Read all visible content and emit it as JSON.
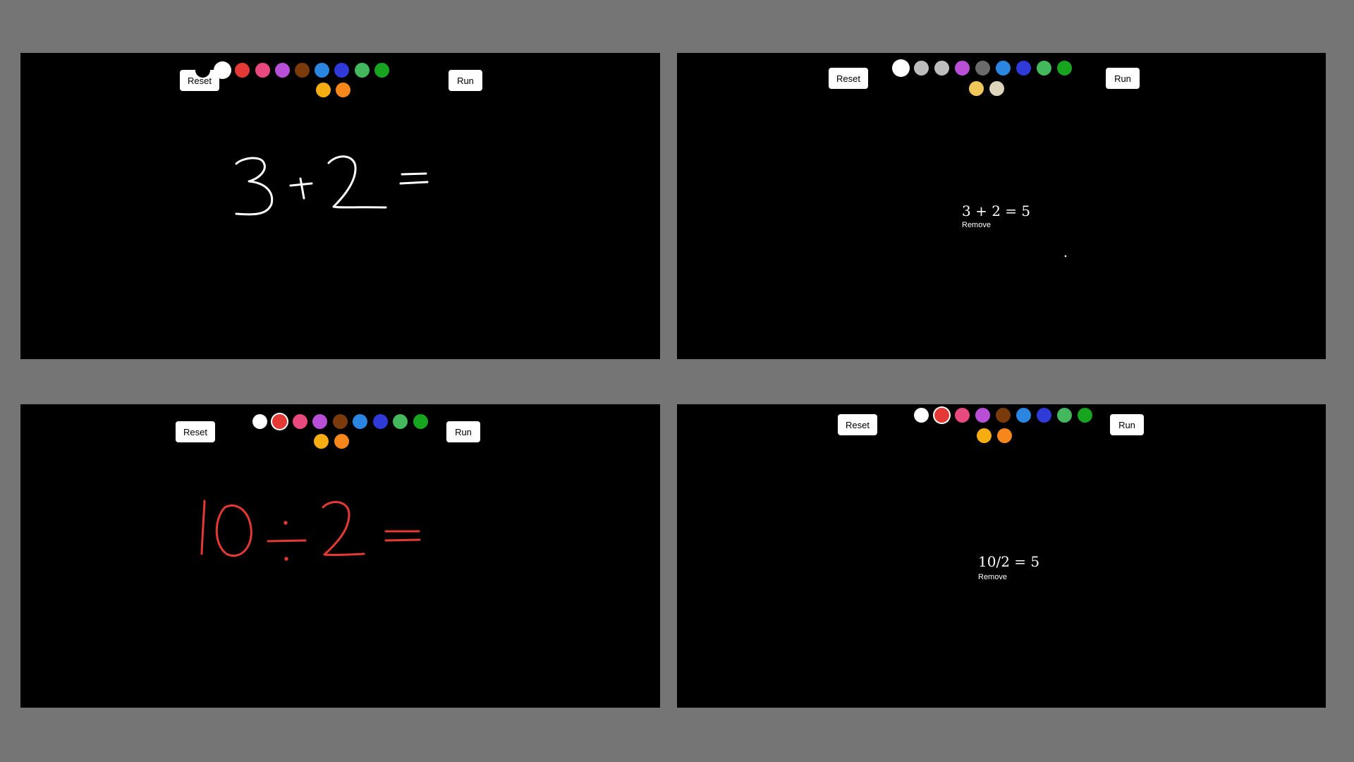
{
  "panels": [
    {
      "reset_label": "Reset",
      "run_label": "Run",
      "selected_color": "#ffffff",
      "stroke_color": "#ffffff"
    },
    {
      "reset_label": "Reset",
      "run_label": "Run",
      "result": {
        "expression": "3 + 2 = 5",
        "remove_label": "Remove"
      }
    },
    {
      "reset_label": "Reset",
      "run_label": "Run",
      "selected_color": "#e53935",
      "stroke_color": "#e53935"
    },
    {
      "reset_label": "Reset",
      "run_label": "Run",
      "selected_color": "#e53935",
      "result": {
        "expression": "10/2 = 5",
        "remove_label": "Remove"
      }
    }
  ],
  "palette": [
    "#000000",
    "#ffffff",
    "#e53935",
    "#e84a7f",
    "#b84fd6",
    "#7a3a0a",
    "#2a86e0",
    "#2f3ad8",
    "#43b85c",
    "#17a51f",
    "#f5ad12",
    "#f7861b"
  ],
  "palette_alt": [
    "#000000",
    "#ffffff",
    "#bdbdbd",
    "#bdbdbd",
    "#b84fd6",
    "#6b6b6b",
    "#2a86e0",
    "#2f3ad8",
    "#43b85c",
    "#17a51f",
    "#f0c85a",
    "#dcd5bb"
  ]
}
